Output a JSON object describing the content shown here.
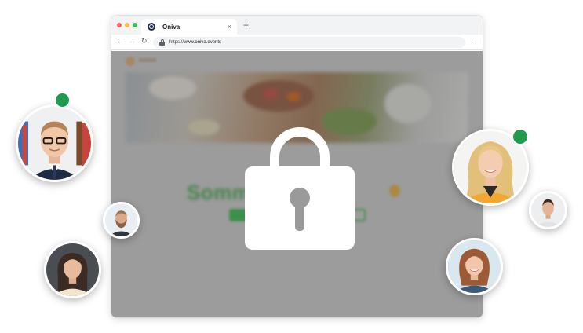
{
  "browser": {
    "tab_title": "Oniva",
    "tab_close": "×",
    "new_tab": "+",
    "url_prefix": "https://",
    "url_host": "www.oniva.events",
    "nav_back": "←",
    "nav_forward": "→",
    "nav_reload": "↻",
    "menu": "⋮"
  },
  "page": {
    "event_title": "Somm        26",
    "state": "locked"
  },
  "overlay": {
    "icon": "padlock-icon"
  },
  "avatars": [
    {
      "name": "man-glasses",
      "online": true
    },
    {
      "name": "man-beard",
      "online": false
    },
    {
      "name": "woman-dark-hair",
      "online": false
    },
    {
      "name": "woman-blonde",
      "online": true
    },
    {
      "name": "man-short-hair",
      "online": false
    },
    {
      "name": "woman-auburn",
      "online": false
    }
  ],
  "colors": {
    "status_online": "#1e9b4d",
    "event_title_green": "#2f9e3f",
    "cta_green": "#24b33e"
  }
}
